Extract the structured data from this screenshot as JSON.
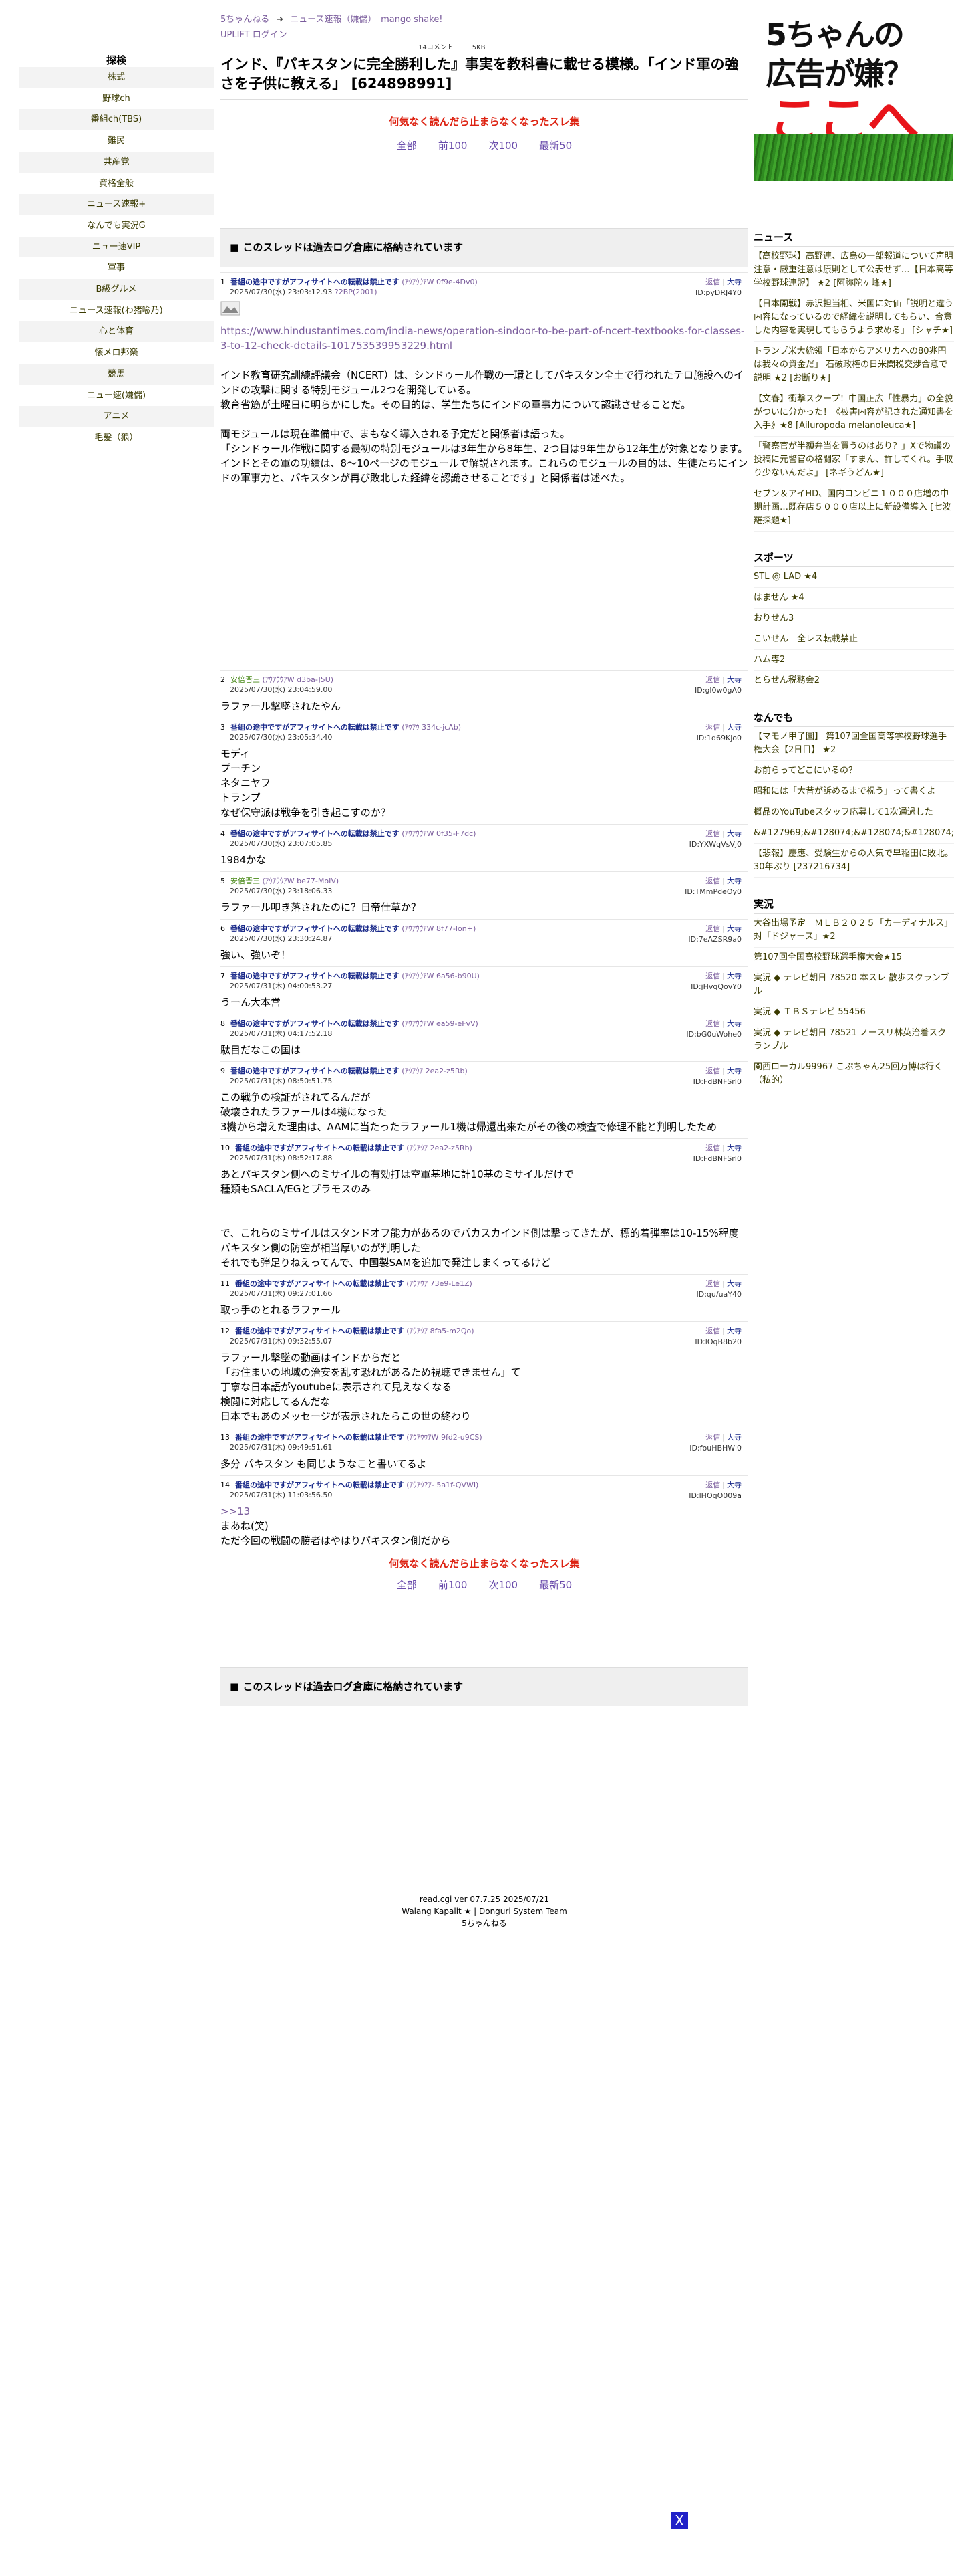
{
  "nav": {
    "header": "探検",
    "items": [
      "株式",
      "野球ch",
      "番組ch(TBS)",
      "難民",
      "共産党",
      "資格全般",
      "ニュース速報+",
      "なんでも実況G",
      "ニュー速VIP",
      "軍事",
      "B級グルメ",
      "ニュース速報(わ猪喩乃)",
      "心と体育",
      "懐メロ邦楽",
      "競馬",
      "ニュー速(嫌儲)",
      "アニメ",
      "毛髪（狼）"
    ]
  },
  "breadcrumb": {
    "home": "5ちゃんねる",
    "arrow": "➜",
    "board": "ニュース速報（嫌儲）",
    "extra": "mango shake!",
    "uplift": "UPLIFT ログイン"
  },
  "thread": {
    "comments": "14コメント",
    "size": "5KB",
    "title": "インド、『パキスタンに完全勝利した』事実を教科書に載せる模様。「インド軍の強さを子供に教える」 [624898991]",
    "promo": "何気なく読んだら止まらなくなったスレ集",
    "pager": [
      "全部",
      "前100",
      "次100",
      "最新50"
    ],
    "archived": "■ このスレッドは過去ログ倉庫に格納されています"
  },
  "post_actions": {
    "reply": "返信",
    "sep": "|",
    "big": "大寺"
  },
  "posts": [
    {
      "no": "1",
      "name": "番組の途中ですがアフィサイトへの転載は禁止です",
      "trip": "(ｱｳｱｳｳｱW 0f9e-4Dv0)",
      "date": "2025/07/30(水) 23:03:12.93",
      "be": "?2BP(2001)",
      "id": "ID:pyDRJ4Y0",
      "link": "https://www.hindustantimes.com/india-news/operation-sindoor-to-be-part-of-ncert-textbooks-for-classes-3-to-12-check-details-101753539953229.html",
      "body": "インド教育研究訓練評議会（NCERT）は、シンドゥール作戦の一環としてパキスタン全土で行われたテロ施設へのインドの攻撃に関する特別モジュール2つを開発している。\n教育省筋が土曜日に明らかにした。その目的は、学生たちにインドの軍事力について認識させることだ。\n\n両モジュールは現在準備中で、まもなく導入される予定だと関係者は語った。\n「シンドゥール作戦に関する最初の特別モジュールは3年生から8年生、2つ目は9年生から12年生が対象となります。\nインドとその軍の功績は、8〜10ページのモジュールで解説されます。これらのモジュールの目的は、生徒たちにインドの軍事力と、パキスタンが再び敗北した経緯を認識させることです」と関係者は述べた。"
    },
    {
      "no": "2",
      "name": "安倍晋三",
      "trip": "(ｱｳｱｳｳｱW d3ba-J5U)",
      "date": "2025/07/30(水) 23:04:59.00",
      "id": "ID:gl0w0gA0",
      "body": "ラファール撃墜されたやん"
    },
    {
      "no": "3",
      "name": "番組の途中ですがアフィサイトへの転載は禁止です",
      "trip": "(ｱｳｱｳ 334c-jcAb)",
      "date": "2025/07/30(水) 23:05:34.40",
      "id": "ID:1d69Kjo0",
      "body": "モディ\nプーチン\nネタニヤフ\nトランプ\nなぜ保守派は戦争を引き起こすのか？"
    },
    {
      "no": "4",
      "name": "番組の途中ですがアフィサイトへの転載は禁止です",
      "trip": "(ｱｳｱｳｳｱW 0f35-F7dc)",
      "date": "2025/07/30(水) 23:07:05.85",
      "id": "ID:YXWqVsVj0",
      "body": "1984かな"
    },
    {
      "no": "5",
      "name": "安倍晋三",
      "trip": "(ｱｳｱｳｳｱW be77-MoIV)",
      "date": "2025/07/30(水) 23:18:06.33",
      "id": "ID:TMmPdeOy0",
      "body": "ラファール叩き落されたのに？日帝仕草か？"
    },
    {
      "no": "6",
      "name": "番組の途中ですがアフィサイトへの転載は禁止です",
      "trip": "(ｱｳｱｳｳｱW 8f77-Ion+)",
      "date": "2025/07/30(水) 23:30:24.87",
      "id": "ID:7eAZSR9a0",
      "body": "強い、強いぞ！"
    },
    {
      "no": "7",
      "name": "番組の途中ですがアフィサイトへの転載は禁止です",
      "trip": "(ｱｳｱｳｳｱW 6a56-b90U)",
      "date": "2025/07/31(木) 04:00:53.27",
      "id": "ID:jHvqQovY0",
      "body": "うーん大本営"
    },
    {
      "no": "8",
      "name": "番組の途中ですがアフィサイトへの転載は禁止です",
      "trip": "(ｱｳｱｳｳｱW ea59-eFvV)",
      "date": "2025/07/31(木) 04:17:52.18",
      "id": "ID:bG0uWohe0",
      "body": "駄目だなこの国は"
    },
    {
      "no": "9",
      "name": "番組の途中ですがアフィサイトへの転載は禁止です",
      "trip": "(ｱｳｱｳｱ 2ea2-z5Rb)",
      "date": "2025/07/31(木) 08:50:51.75",
      "id": "ID:FdBNFSrI0",
      "body": "この戦争の検証がされてるんだが\n破壊されたラファールは4機になった\n3機から増えた理由は、AAMに当たったラファール1機は帰還出来たがその後の検査で修理不能と判明したため"
    },
    {
      "no": "10",
      "name": "番組の途中ですがアフィサイトへの転載は禁止です",
      "trip": "(ｱｳｱｳｱ 2ea2-z5Rb)",
      "date": "2025/07/31(木) 08:52:17.88",
      "id": "ID:FdBNFSrI0",
      "body": "あとパキスタン側へのミサイルの有効打は空軍基地に計10基のミサイルだけで\n種類もSACLA/EGとブラモスのみ\n\n\nで、これらのミサイルはスタンドオフ能力があるのでパカスカインド側は撃ってきたが、標的着弾率は10-15%程度\nパキスタン側の防空が相当厚いのが判明した\nそれでも弾足りねえってんで、中国製SAMを追加で発注しまくってるけど"
    },
    {
      "no": "11",
      "name": "番組の途中ですがアフィサイトへの転載は禁止です",
      "trip": "(ｱｳｱｳｱ 73e9-Le1Z)",
      "date": "2025/07/31(木) 09:27:01.66",
      "id": "ID:qu/uaY40",
      "body": "取っ手のとれるラファール"
    },
    {
      "no": "12",
      "name": "番組の途中ですがアフィサイトへの転載は禁止です",
      "trip": "(ｱｳｱｳｱ 8fa5-m2Qo)",
      "date": "2025/07/31(木) 09:32:55.07",
      "id": "ID:lOqB8b20",
      "body": "ラファール撃墜の動画はインドからだと\n「お住まいの地域の治安を乱す恐れがあるため視聴できません」て\n丁寧な日本語がyoutubeに表示されて見えなくなる\n検閲に対応してるんだな\n日本でもあのメッセージが表示されたらこの世の終わり"
    },
    {
      "no": "13",
      "name": "番組の途中ですがアフィサイトへの転載は禁止です",
      "trip": "(ｱｳｱｳｳｱW 9fd2-u9CS)",
      "date": "2025/07/31(木) 09:49:51.61",
      "id": "ID:fouHBHWi0",
      "body": "多分 パキスタン も同じようなこと書いてるよ"
    },
    {
      "no": "14",
      "name": "番組の途中ですがアフィサイトへの転載は禁止です",
      "trip": "(ｱｳｱｳ?ｱ- 5a1f-QVWI)",
      "date": "2025/07/31(木) 11:03:56.50",
      "id": "ID:lHOqO009a",
      "anchor": ">>13",
      "body": "まあね(笑)\nただ今回の戦闘の勝者はやはりパキスタン側だから"
    }
  ],
  "footer": {
    "line1": "read.cgi ver 07.7.25 2025/07/21",
    "line2": "Walang Kapalit ★ | Donguri System Team",
    "line3": "5ちゃんねる"
  },
  "ad": {
    "line1": "5ちゃんの",
    "line2": "広告が嫌？",
    "line3": "ここへ"
  },
  "right": {
    "sections": [
      {
        "title": "ニュース",
        "items": [
          "【高校野球】高野連、広島の一部報道について声明　注意・厳重注意は原則として公表せず…【日本高等学校野球連盟】 ★2 [阿弥陀ヶ峰★]",
          "【日本開戦】赤沢担当相、米国に対価「説明と違う内容になっているので経緯を説明してもらい、合意した内容を実現してもらうよう求める」 [シャチ★]",
          "トランプ米大統領「日本からアメリカへの80兆円は我々の資金だ」 石破政権の日米関税交渉合意で説明 ★2 [お断り★]",
          "【文春】衝撃スクープ！中国正広「性暴力」の全貌がついに分かった！《被害内容が記された通知書を入手》★8 [Ailuropoda melanoleuca★]",
          "「警察官が半額弁当を買うのはあり？」Xで物議の投稿に元警官の格闘家「すまん、許してくれ。手取り少ないんだよ」 [ネギうどん★]",
          "セブン＆アイHD、国内コンビニ１０００店増の中期計画…既存店５０００店以上に新設備導入 [七波羅探題★]"
        ]
      },
      {
        "title": "スポーツ",
        "items": [
          "STL @ LAD ★4",
          "はません ★4",
          "おりせん3",
          "こいせん　全レス転載禁止",
          "ハム専2",
          "とらせん税務会2"
        ]
      },
      {
        "title": "なんでも",
        "items": [
          "【マモノ甲子園】 第107回全国高等学校野球選手権大会【2日目】 ★2",
          "お前らってどこにいるの？",
          "昭和には「大昔が訴めるまで祝う」って書くよ",
          "概品のYouTubeスタッフ応募して1次通過した",
          "&#127969;&#128074;&#128074;&#128074;",
          "【悲報】慶應、受験生からの人気で早稲田に敗北。30年ぶり [237216734]"
        ]
      },
      {
        "title": "実況",
        "items": [
          "大谷出場予定　ＭＬＢ２０２５「カーディナルス」対「ドジャース」★2",
          "第107回全国高校野球選手権大会★15",
          "実況 ◆ テレビ朝日 78520 本スレ 散歩スクランブル",
          "実況 ◆ ＴＢＳテレビ 55456",
          "実況 ◆ テレビ朝日 78521 ノースリ林英治着スクランブル",
          "関西ローカル99967 こぶちゃん25回万博は行く（私的）"
        ]
      }
    ]
  },
  "close": {
    "label": "X"
  }
}
